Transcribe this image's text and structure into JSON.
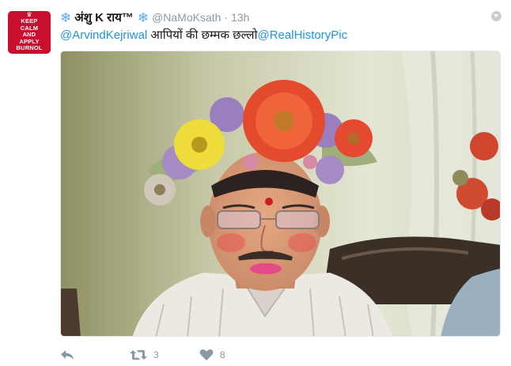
{
  "tweet": {
    "display_name": "अंशु K राय™",
    "name_ornament": "❄",
    "handle": "@NaMoKsath",
    "separator": "·",
    "timestamp": "13h",
    "text_parts": [
      {
        "type": "mention",
        "text": "@ArvindKejriwal"
      },
      {
        "type": "text",
        "text": " आपियों की छम्मक छल्लो"
      },
      {
        "type": "mention",
        "text": "@RealHistoryPic"
      }
    ]
  },
  "avatar": {
    "lines": [
      "KEEP",
      "CALM",
      "AND",
      "APPLY",
      "BURNOL"
    ],
    "background": "#c8102e"
  },
  "actions": {
    "reply_icon": "reply-icon",
    "retweet_icon": "retweet-icon",
    "retweet_count": "3",
    "like_icon": "heart-icon",
    "like_count": "8"
  },
  "colors": {
    "link": "#1b95e0",
    "muted": "#8899a6",
    "snowflake": "#55acee"
  }
}
